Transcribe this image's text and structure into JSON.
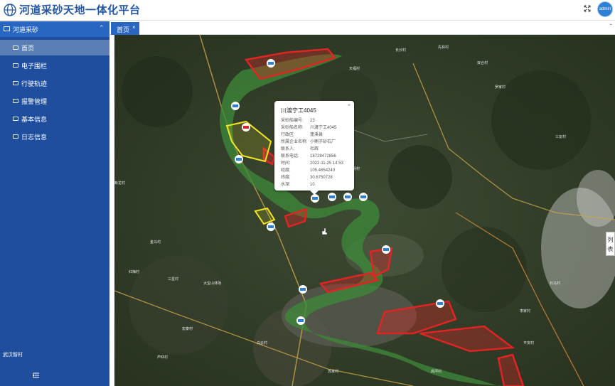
{
  "header": {
    "title": "河道采砂天地一体化平台",
    "avatar_text": "admin"
  },
  "sidebar": {
    "group_label": "河道采砂",
    "items": [
      {
        "label": "首页"
      },
      {
        "label": "电子围栏"
      },
      {
        "label": "行驶轨迹"
      },
      {
        "label": "报警管理"
      },
      {
        "label": "基本信息"
      },
      {
        "label": "日志信息"
      }
    ],
    "footer": "武汉智村"
  },
  "tabs": [
    {
      "label": "首页"
    }
  ],
  "map": {
    "list_toggle_label": "列表",
    "popup": {
      "title": "川渡宁工4045",
      "close": "×",
      "rows": [
        {
          "key": "采砂船编号:",
          "value": "23"
        },
        {
          "key": "采砂船名称:",
          "value": "川渡宁工4045"
        },
        {
          "key": "行政区:",
          "value": "蓬溪县"
        },
        {
          "key": "所属企业名称:",
          "value": "小喇子砂石厂"
        },
        {
          "key": "联系人:",
          "value": "杜辉"
        },
        {
          "key": "联系电话:",
          "value": "18728472856"
        },
        {
          "key": "时间:",
          "value": "2022-11-25 14:53"
        },
        {
          "key": "经度:",
          "value": "105.4654240"
        },
        {
          "key": "纬度:",
          "value": "30.6750728"
        },
        {
          "key": "水深:",
          "value": "10"
        }
      ]
    },
    "places": [
      "天福村",
      "长沙村",
      "先林村",
      "双合村",
      "罗家村",
      "三友村",
      "红梅村",
      "新龙村",
      "光明村",
      "金马村",
      "三星村",
      "大宝山林场",
      "白云村",
      "苏家村",
      "高坪村",
      "芦林村",
      "宏泰村",
      "石马村",
      "李家村",
      "平安村"
    ]
  },
  "colors": {
    "header_title": "#2457a8",
    "sidebar_bg": "#1f4e9e",
    "menu_active": "#5a7fb7",
    "fence_red": "#e02424",
    "fence_yellow": "#f0e620",
    "river_green": "#3d8a3a"
  }
}
